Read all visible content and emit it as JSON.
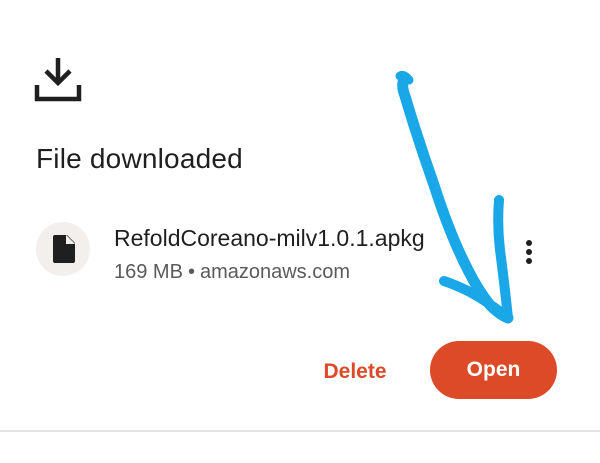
{
  "header": {
    "icon": "download-icon",
    "title": "File downloaded"
  },
  "file": {
    "icon": "file-icon",
    "name": "RefoldCoreano-milv1.0.1.apkg",
    "size": "169 MB",
    "separator": "•",
    "source": "amazonaws.com",
    "menu_icon": "more-vert-icon"
  },
  "actions": {
    "delete_label": "Delete",
    "open_label": "Open"
  },
  "annotation": {
    "type": "hand-drawn-arrow",
    "color": "#1aa7e8"
  },
  "colors": {
    "accent": "#dc4a27",
    "text_primary": "#1f1f1f",
    "text_secondary": "#5a5a5a",
    "avatar_bg": "#f2efed",
    "divider": "#e6e6e6"
  }
}
